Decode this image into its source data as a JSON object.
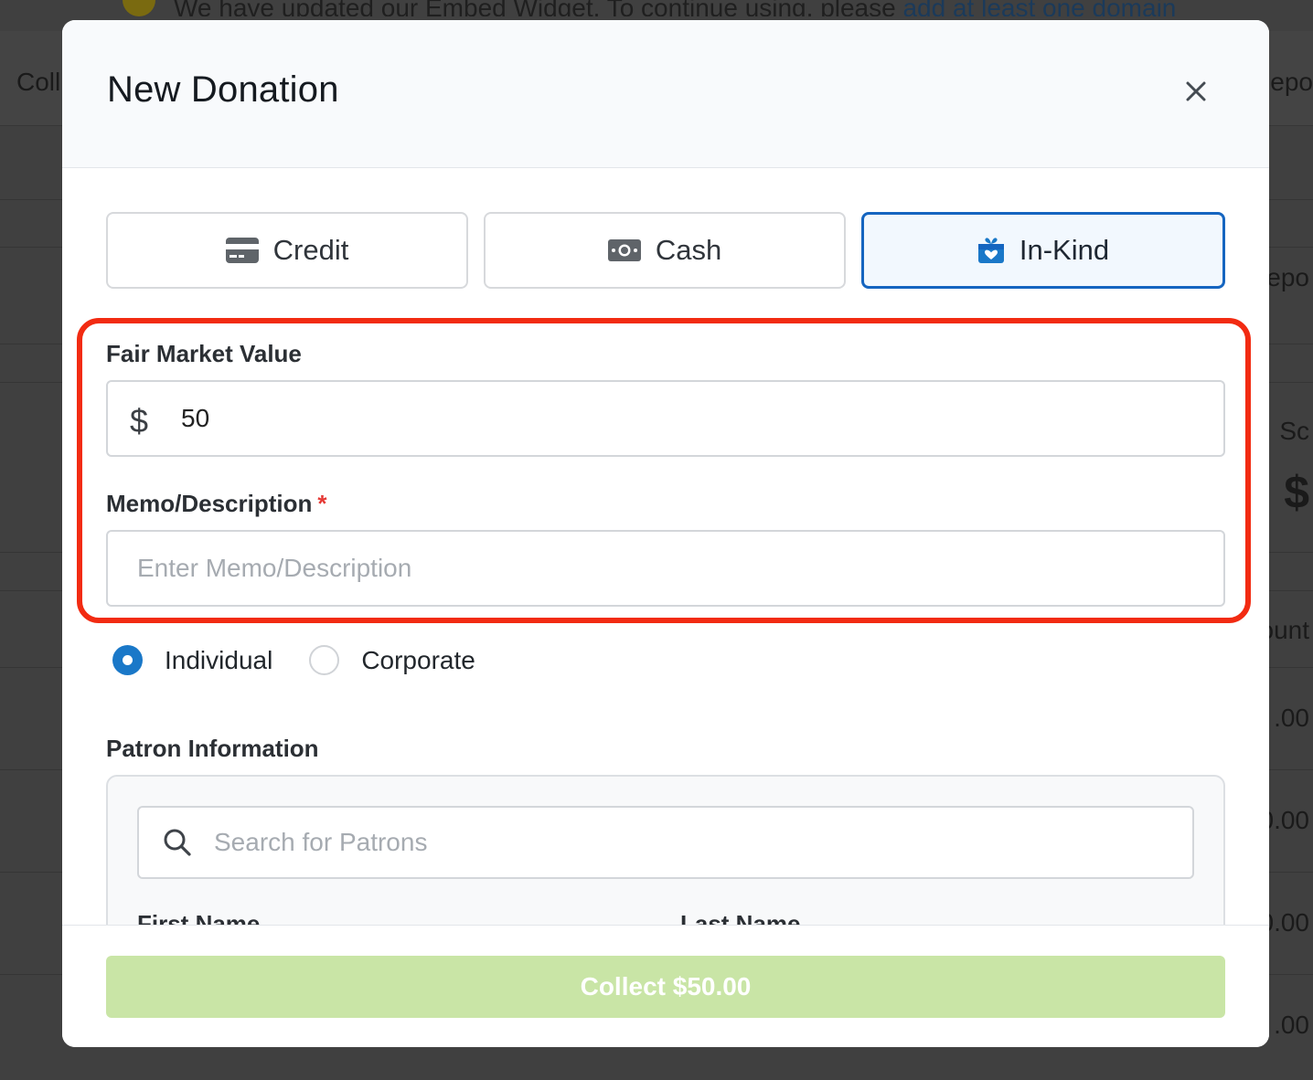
{
  "background": {
    "banner_text": "We have updated our Embed Widget. To continue using, please ",
    "banner_link": "add at least one domain",
    "nav_left": "Coll",
    "nav_right": "epo",
    "side_texts": [
      "epo",
      "Sc",
      "$",
      "ount",
      ".00",
      "0.00",
      "0.00",
      ".00"
    ]
  },
  "modal": {
    "title": "New Donation",
    "close_icon": "close-icon",
    "tabs": [
      {
        "label": "Credit",
        "icon": "credit-card-icon",
        "active": false
      },
      {
        "label": "Cash",
        "icon": "cash-icon",
        "active": false
      },
      {
        "label": "In-Kind",
        "icon": "gift-icon",
        "active": true
      }
    ],
    "fair_market_value": {
      "label": "Fair Market Value",
      "currency_symbol": "$",
      "value": "50"
    },
    "memo": {
      "label": "Memo/Description",
      "required_marker": "*",
      "placeholder": "Enter Memo/Description",
      "value": ""
    },
    "donor_type": {
      "options": [
        {
          "label": "Individual",
          "checked": true
        },
        {
          "label": "Corporate",
          "checked": false
        }
      ]
    },
    "patron": {
      "section_label": "Patron Information",
      "search_placeholder": "Search for Patrons",
      "first_name_label": "First Name",
      "last_name_label": "Last Name"
    },
    "footer": {
      "collect_label": "Collect $50.00"
    }
  },
  "colors": {
    "accent": "#1565c0",
    "radio_checked": "#1a78c8",
    "highlight": "#f22b12",
    "collect_button": "#c9e5a6",
    "required": "#e53935"
  }
}
